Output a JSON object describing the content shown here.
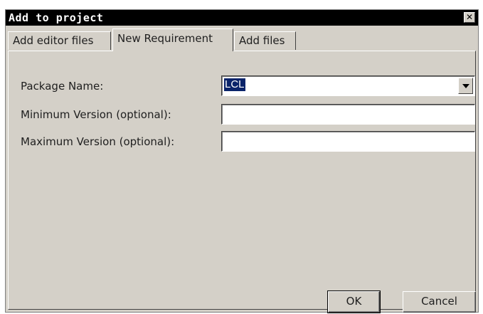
{
  "window": {
    "title": "Add to project",
    "close_symbol": "✕"
  },
  "tabs": [
    {
      "label": "Add editor files",
      "active": false
    },
    {
      "label": "New Requirement",
      "active": true
    },
    {
      "label": "Add files",
      "active": false
    }
  ],
  "form": {
    "package_name_label": "Package Name:",
    "package_name_value": "LCL",
    "min_version_label": "Minimum Version (optional):",
    "min_version_value": "",
    "max_version_label": "Maximum Version (optional):",
    "max_version_value": ""
  },
  "buttons": {
    "ok_label": "OK",
    "cancel_label": "Cancel"
  },
  "icons": {
    "close": "close-icon",
    "dropdown": "chevron-down-icon"
  }
}
